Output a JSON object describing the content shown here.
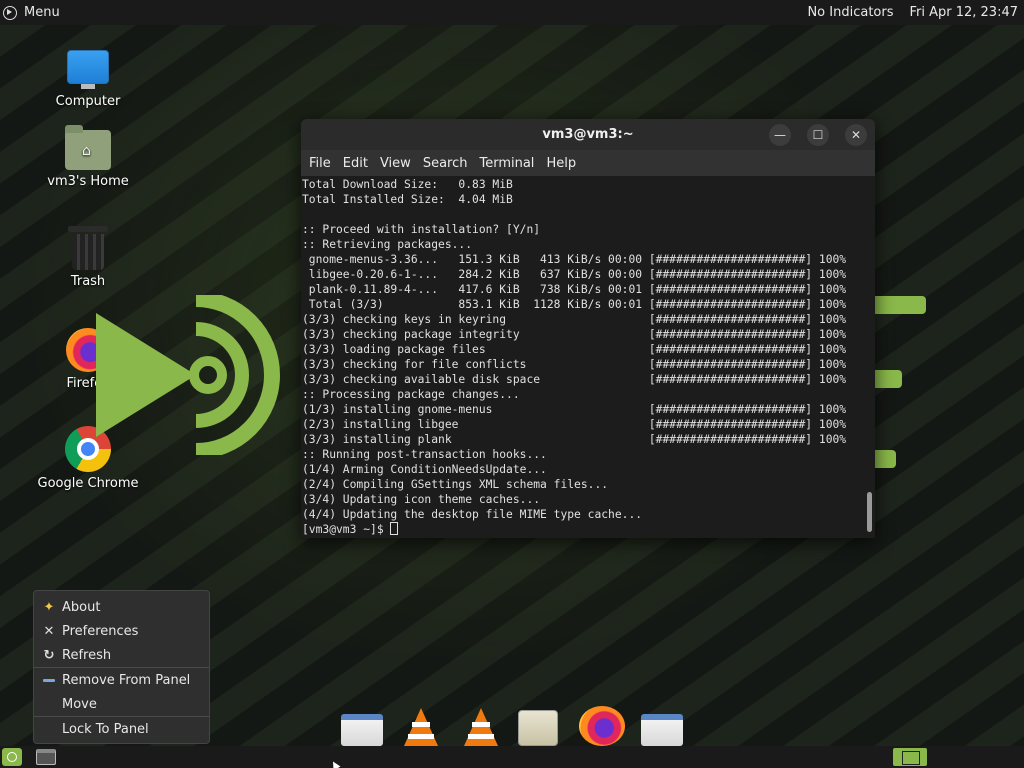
{
  "top_panel": {
    "menu_label": "Menu",
    "indicators": "No Indicators",
    "clock": "Fri Apr 12, 23:47"
  },
  "desktop_icons": [
    {
      "label": "Computer",
      "icon": "computer-icon"
    },
    {
      "label": "vm3's Home",
      "icon": "home-folder-icon"
    },
    {
      "label": "Trash",
      "icon": "trash-icon"
    },
    {
      "label": "Firefox",
      "icon": "firefox-icon"
    },
    {
      "label": "Google Chrome",
      "icon": "chrome-icon"
    }
  ],
  "terminal": {
    "title": "vm3@vm3:~",
    "menu": [
      "File",
      "Edit",
      "View",
      "Search",
      "Terminal",
      "Help"
    ],
    "lines": [
      "Total Download Size:   0.83 MiB",
      "Total Installed Size:  4.04 MiB",
      "",
      ":: Proceed with installation? [Y/n]",
      ":: Retrieving packages...",
      " gnome-menus-3.36...   151.3 KiB   413 KiB/s 00:00 [######################] 100%",
      " libgee-0.20.6-1-...   284.2 KiB   637 KiB/s 00:00 [######################] 100%",
      " plank-0.11.89-4-...   417.6 KiB   738 KiB/s 00:01 [######################] 100%",
      " Total (3/3)           853.1 KiB  1128 KiB/s 00:01 [######################] 100%",
      "(3/3) checking keys in keyring                     [######################] 100%",
      "(3/3) checking package integrity                   [######################] 100%",
      "(3/3) loading package files                        [######################] 100%",
      "(3/3) checking for file conflicts                  [######################] 100%",
      "(3/3) checking available disk space                [######################] 100%",
      ":: Processing package changes...",
      "(1/3) installing gnome-menus                       [######################] 100%",
      "(2/3) installing libgee                            [######################] 100%",
      "(3/3) installing plank                             [######################] 100%",
      ":: Running post-transaction hooks...",
      "(1/4) Arming ConditionNeedsUpdate...",
      "(2/4) Compiling GSettings XML schema files...",
      "(3/4) Updating icon theme caches...",
      "(4/4) Updating the desktop file MIME type cache..."
    ],
    "prompt": "[vm3@vm3 ~]$ "
  },
  "context_menu": {
    "items": [
      {
        "label": "About",
        "icon": "star-icon"
      },
      {
        "label": "Preferences",
        "icon": "tools-icon"
      },
      {
        "label": "Refresh",
        "icon": "refresh-icon"
      },
      {
        "label": "Remove From Panel",
        "icon": "minus-icon"
      },
      {
        "label": "Move",
        "icon": ""
      },
      {
        "label": "Lock To Panel",
        "icon": ""
      }
    ]
  },
  "dock": [
    "window-icon",
    "vlc-icon",
    "vlc-icon",
    "image-viewer-icon",
    "firefox-icon",
    "window-icon"
  ],
  "colors": {
    "accent": "#8ab84a",
    "panel": "#1a1a1a",
    "terminal_bg": "#1c1c1c"
  }
}
